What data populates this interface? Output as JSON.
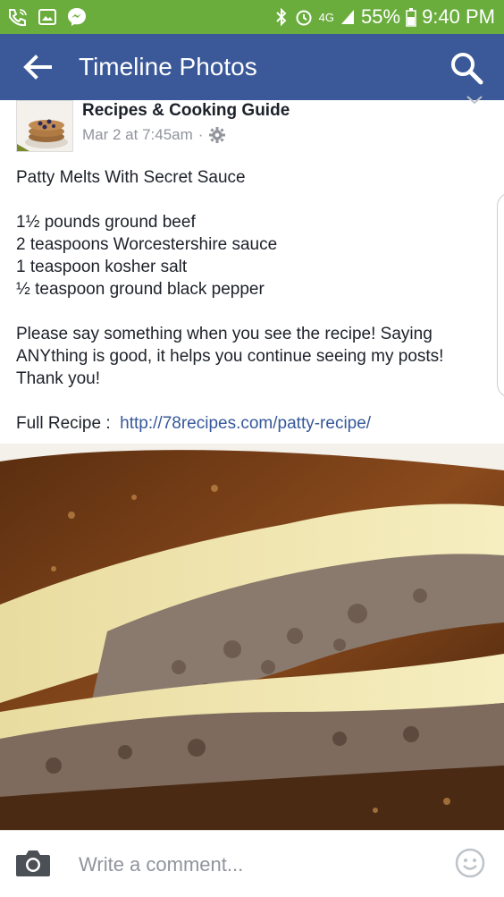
{
  "status_bar": {
    "network": "4G",
    "battery": "55%",
    "time": "9:40 PM",
    "icons": [
      "phone-wifi-icon",
      "gallery-icon",
      "messenger-icon",
      "bluetooth-icon",
      "alarm-icon",
      "signal-icon",
      "battery-icon"
    ]
  },
  "app_bar": {
    "title": "Timeline Photos",
    "back_icon": "arrow-left-icon",
    "search_icon": "search-icon"
  },
  "post": {
    "page_name": "Recipes & Cooking Guide",
    "timestamp": "Mar 2 at 7:45am",
    "separator": "·",
    "privacy_icon": "gear-icon",
    "title": "Patty Melts With Secret Sauce",
    "ingredients": [
      "1½ pounds ground beef",
      "2 teaspoons Worcestershire sauce",
      "1 teaspoon kosher salt",
      "½ teaspoon ground black pepper"
    ],
    "message": [
      "Please say something when you see the recipe! Saying",
      "ANYthing is good, it helps you continue seeing my posts!",
      "Thank you!"
    ],
    "full_recipe_label": "Full Recipe :",
    "full_recipe_link": "http://78recipes.com/patty-recipe/"
  },
  "comment_bar": {
    "placeholder": "Write a comment...",
    "camera_icon": "camera-icon",
    "emoji_icon": "smiley-icon"
  },
  "colors": {
    "status_bar": "#6aad3d",
    "app_bar": "#3b5998",
    "link": "#365899",
    "text": "#1d2129",
    "meta": "#90949c"
  }
}
